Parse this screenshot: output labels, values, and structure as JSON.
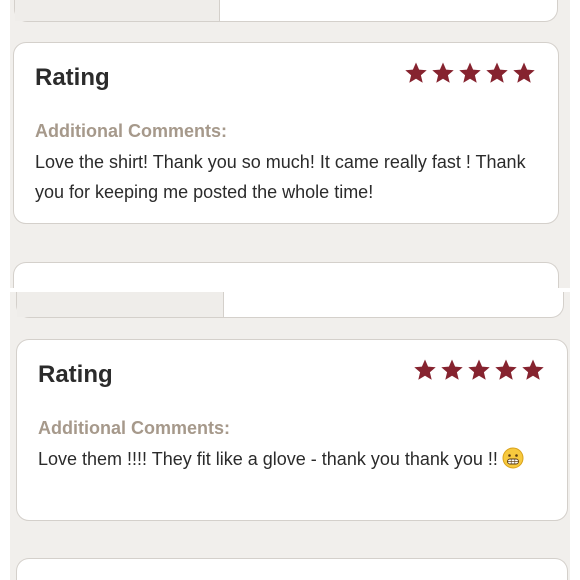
{
  "reviews": [
    {
      "rating_label": "Rating",
      "stars_filled": 5,
      "stars_total": 5,
      "comments_label": "Additional Comments:",
      "comment": "Love the shirt! Thank you so much! It came really fast ! Thank you for keeping me posted the whole time!",
      "emoji": ""
    },
    {
      "rating_label": "Rating",
      "stars_filled": 5,
      "stars_total": 5,
      "comments_label": "Additional Comments:",
      "comment": "Love them !!!! They fit like a glove - thank you thank you !!",
      "emoji": "grinning-face-icon"
    }
  ],
  "colors": {
    "star": "#86232f",
    "label_muted": "#a6998b",
    "text": "#2b2b2b",
    "background": "#f1efec"
  }
}
